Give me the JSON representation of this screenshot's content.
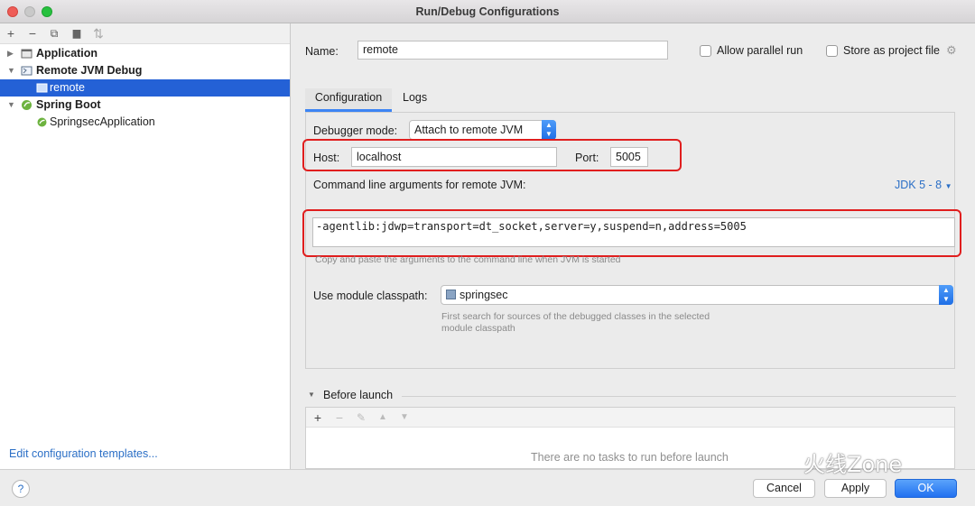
{
  "window": {
    "title": "Run/Debug Configurations"
  },
  "toolbar_icons": [
    "add-icon",
    "remove-icon",
    "copy-icon",
    "folder-icon",
    "sort-icon"
  ],
  "toolbar_glyphs": {
    "add": "+",
    "remove": "−",
    "copy": "⧉",
    "folder": "▆",
    "sort": "⇅"
  },
  "tree": {
    "application": "Application",
    "remote_jvm_debug": "Remote JVM Debug",
    "remote": "remote",
    "spring_boot": "Spring Boot",
    "springsec_app": "SpringsecApplication"
  },
  "edit_templates": "Edit configuration templates...",
  "form": {
    "name_label": "Name:",
    "name_value": "remote",
    "allow_parallel": "Allow parallel run",
    "store_project": "Store as project file"
  },
  "tabs": {
    "configuration": "Configuration",
    "logs": "Logs"
  },
  "config": {
    "debugger_mode_label": "Debugger mode:",
    "debugger_mode_value": "Attach to remote JVM",
    "host_label": "Host:",
    "host_value": "localhost",
    "port_label": "Port:",
    "port_value": "5005",
    "cmd_label": "Command line arguments for remote JVM:",
    "jdk_label": "JDK 5 - 8",
    "cmd_value": "-agentlib:jdwp=transport=dt_socket,server=y,suspend=n,address=5005",
    "cmd_hint": "Copy and paste the arguments to the command line when JVM is started",
    "classpath_label": "Use module classpath:",
    "classpath_value": "springsec",
    "classpath_hint_1": "First search for sources of the debugged classes in the selected",
    "classpath_hint_2": "module classpath"
  },
  "before_launch": {
    "header": "Before launch",
    "empty": "There are no tasks to run before launch"
  },
  "buttons": {
    "help": "?",
    "cancel": "Cancel",
    "apply": "Apply",
    "ok": "OK"
  },
  "watermark": "火线Zone",
  "colors": {
    "accent": "#2461d6",
    "highlight": "#e01e1e"
  }
}
